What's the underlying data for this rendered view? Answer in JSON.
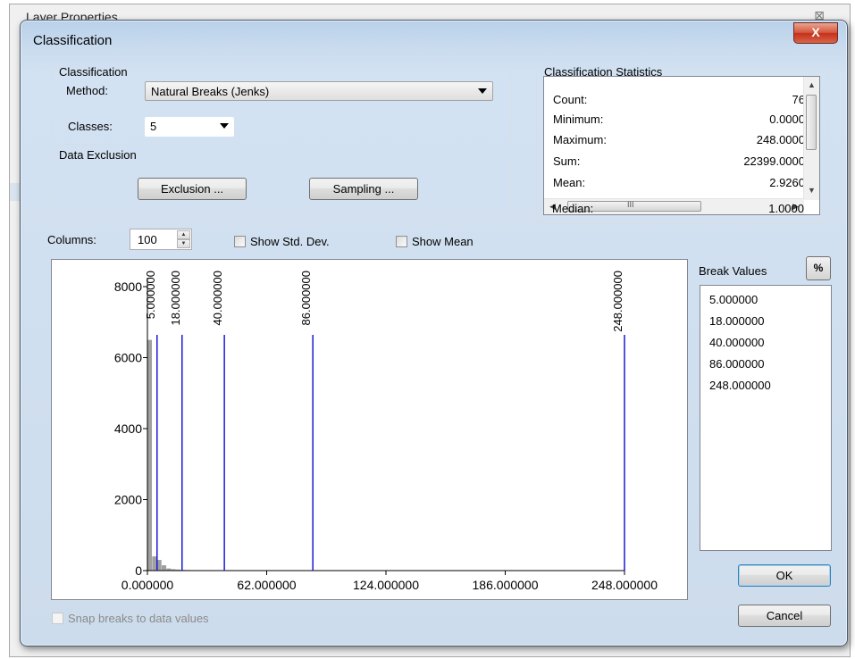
{
  "background_window": {
    "title": "Layer Properties",
    "close_glyph": "⊠"
  },
  "dialog": {
    "title": "Classification",
    "close_label": "X"
  },
  "classification": {
    "group_label": "Classification",
    "method_label": "Method:",
    "method_value": "Natural Breaks (Jenks)",
    "classes_label": "Classes:",
    "classes_value": "5"
  },
  "data_exclusion": {
    "group_label": "Data Exclusion",
    "exclusion_button": "Exclusion ...",
    "sampling_button": "Sampling ..."
  },
  "statistics": {
    "group_label": "Classification Statistics",
    "rows": [
      {
        "key": "Count:",
        "value": "76"
      },
      {
        "key": "Minimum:",
        "value": "0.0000"
      },
      {
        "key": "Maximum:",
        "value": "248.0000"
      },
      {
        "key": "Sum:",
        "value": "22399.0000"
      },
      {
        "key": "Mean:",
        "value": "2.9260"
      },
      {
        "key": "Median:",
        "value": "1.0000"
      }
    ],
    "hscroll_grip": "III"
  },
  "columns": {
    "label": "Columns:",
    "value": "100"
  },
  "options": {
    "show_std_dev": "Show Std. Dev.",
    "show_mean": "Show Mean",
    "snap_breaks": "Snap breaks to data values"
  },
  "break_values": {
    "label": "Break Values",
    "percent_button": "%",
    "items": [
      "5.000000",
      "18.000000",
      "40.000000",
      "86.000000",
      "248.000000"
    ]
  },
  "buttons": {
    "ok": "OK",
    "cancel": "Cancel"
  },
  "chart_data": {
    "type": "bar",
    "title": "",
    "xlabel": "",
    "ylabel": "",
    "xlim": [
      0,
      248
    ],
    "ylim": [
      0,
      8000
    ],
    "x_ticks": [
      "0.000000",
      "62.000000",
      "124.000000",
      "186.000000",
      "248.000000"
    ],
    "x_tick_values": [
      0,
      62,
      124,
      186,
      248
    ],
    "y_ticks": [
      "0",
      "2000",
      "4000",
      "6000",
      "8000"
    ],
    "y_tick_values": [
      0,
      2000,
      4000,
      6000,
      8000
    ],
    "histogram": {
      "bin_width": 2.48,
      "counts": [
        6500,
        400,
        300,
        150,
        60,
        40,
        30,
        20,
        15,
        10,
        10,
        8,
        6,
        5,
        4,
        3,
        3,
        2,
        2,
        2
      ]
    },
    "break_lines": [
      {
        "value": 5,
        "label": "5.000000"
      },
      {
        "value": 18,
        "label": "18.000000"
      },
      {
        "value": 40,
        "label": "40.000000"
      },
      {
        "value": 86,
        "label": "86.000000"
      },
      {
        "value": 248,
        "label": "248.000000"
      }
    ],
    "colors": {
      "break_line": "#1a1ad6",
      "histogram": "#a0a0a0"
    }
  }
}
